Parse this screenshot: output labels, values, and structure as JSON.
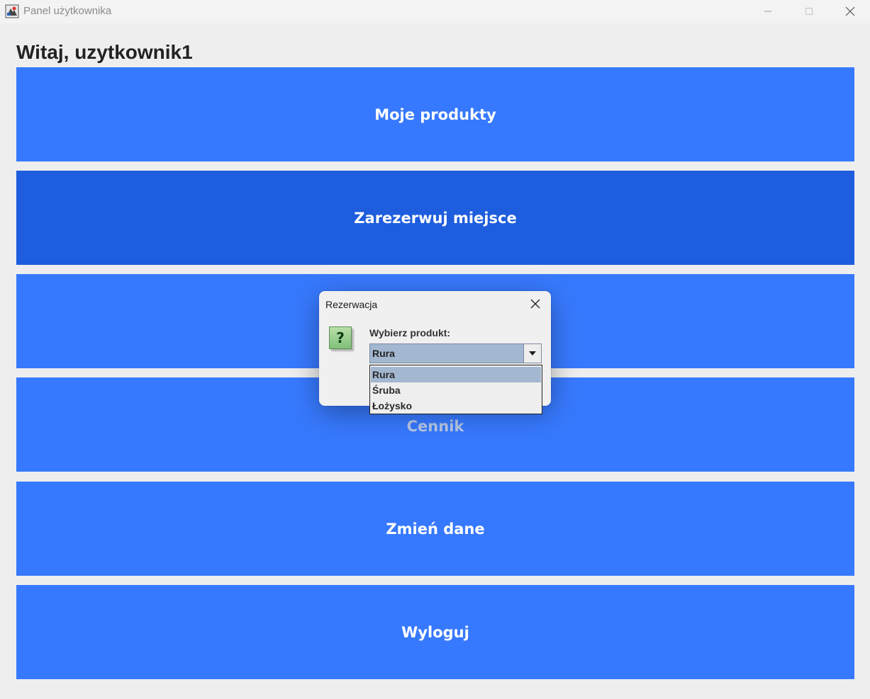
{
  "window": {
    "title": "Panel użytkownika",
    "icons": [
      "app-icon",
      "minimize-icon",
      "maximize-icon",
      "close-icon"
    ]
  },
  "greeting": "Witaj, uzytkownik1",
  "menu": {
    "buttons": [
      {
        "label": "Moje produkty"
      },
      {
        "label": "Zarezerwuj miejsce"
      },
      {
        "label": ""
      },
      {
        "label": "Cennik"
      },
      {
        "label": "Zmień dane"
      },
      {
        "label": "Wyloguj"
      }
    ],
    "colors": {
      "button": "#3779fe",
      "pressed": "#1e5ddd"
    }
  },
  "dialog": {
    "title": "Rezerwacja",
    "icon": "question-icon",
    "icon_glyph": "?",
    "label": "Wybierz produkt:",
    "selected": "Rura",
    "options": [
      "Rura",
      "Śruba",
      "Łożysko"
    ]
  }
}
